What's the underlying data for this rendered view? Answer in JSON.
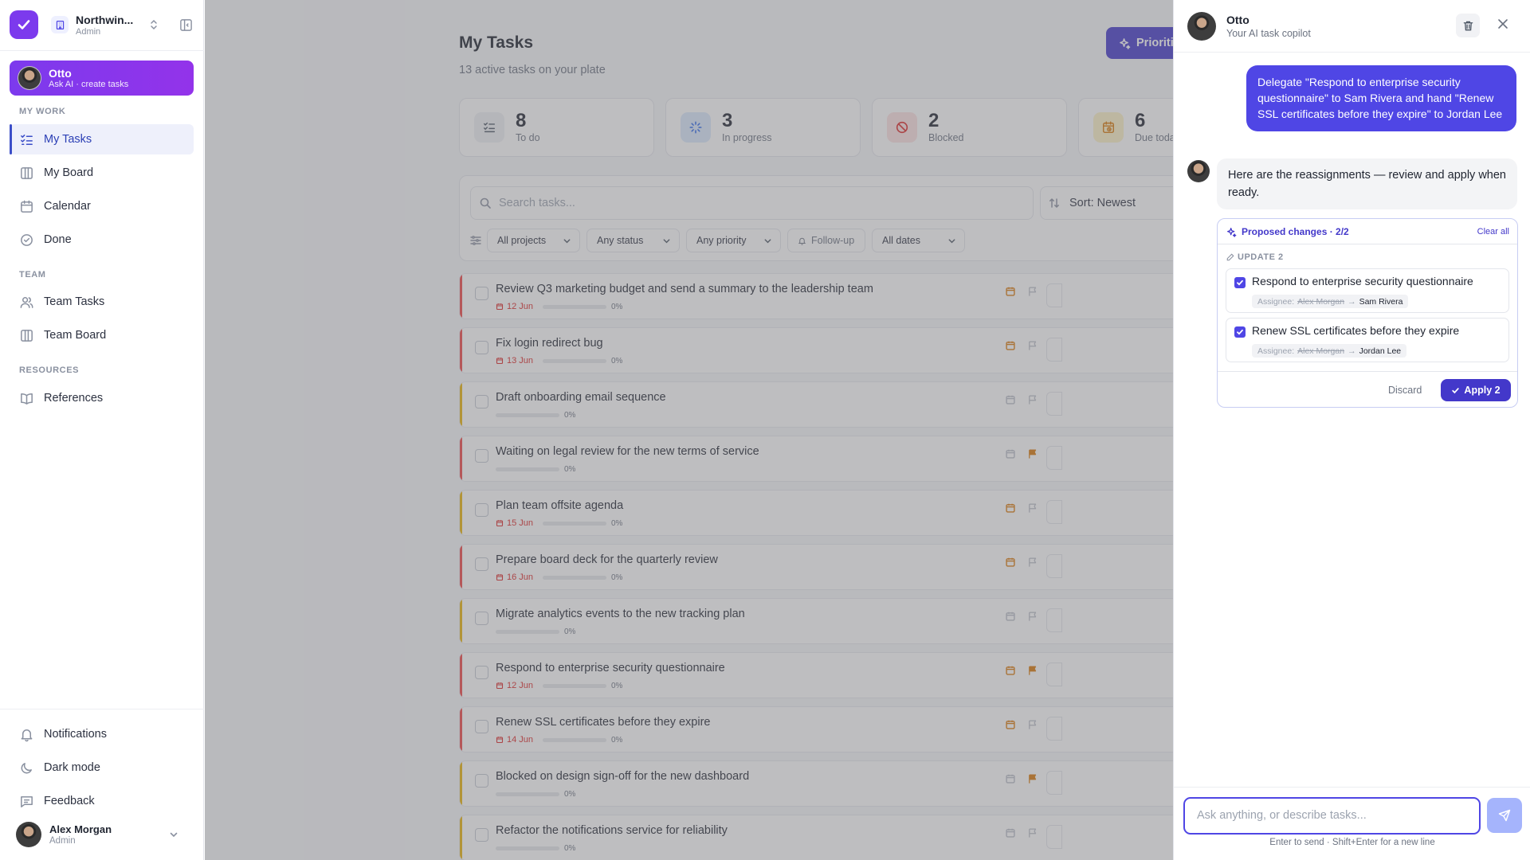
{
  "colors": {
    "accent": "#4338ca",
    "otto_gradient": [
      "#7c3aed",
      "#9333ea"
    ],
    "overdue": "#dc2626",
    "priority_high": "#ef4444",
    "priority_medium": "#eab308"
  },
  "sidebar": {
    "workspace": {
      "name": "Northwin...",
      "role": "Admin"
    },
    "otto": {
      "name": "Otto",
      "subtitle": "Ask AI · create tasks"
    },
    "sections": {
      "my_work": "MY WORK",
      "team": "TEAM",
      "resources": "RESOURCES"
    },
    "nav": {
      "my_tasks": "My Tasks",
      "my_board": "My Board",
      "calendar": "Calendar",
      "done": "Done",
      "team_tasks": "Team Tasks",
      "team_board": "Team Board",
      "references": "References"
    },
    "bottom": {
      "notifications": "Notifications",
      "dark_mode": "Dark mode",
      "feedback": "Feedback"
    },
    "user": {
      "name": "Alex Morgan",
      "role": "Admin"
    }
  },
  "main": {
    "title": "My Tasks",
    "subtitle": "13 active tasks on your plate",
    "prioritize_button": "Prioriti",
    "stats": [
      {
        "value": "8",
        "label": "To do",
        "icon": "list-check-icon"
      },
      {
        "value": "3",
        "label": "In progress",
        "icon": "loader-icon"
      },
      {
        "value": "2",
        "label": "Blocked",
        "icon": "ban-icon"
      },
      {
        "value": "6",
        "label": "Due toda",
        "icon": "calendar-clock-icon"
      }
    ],
    "search": {
      "placeholder": "Search tasks..."
    },
    "sort": {
      "label": "Sort: Newest"
    },
    "filters": {
      "projects": "All projects",
      "status": "Any status",
      "priority": "Any priority",
      "follow_up": "Follow-up",
      "dates": "All dates"
    },
    "tasks": [
      {
        "title": "Review Q3 marketing budget and send a summary to the leadership team",
        "due": "12 Jun",
        "progress": "0%",
        "priority": "high",
        "flagged": false
      },
      {
        "title": "Fix login redirect bug",
        "due": "13 Jun",
        "progress": "0%",
        "priority": "high",
        "flagged": false
      },
      {
        "title": "Draft onboarding email sequence",
        "due": "",
        "progress": "0%",
        "priority": "medium",
        "flagged": false
      },
      {
        "title": "Waiting on legal review for the new terms of service",
        "due": "",
        "progress": "0%",
        "priority": "high",
        "flagged": true
      },
      {
        "title": "Plan team offsite agenda",
        "due": "15 Jun",
        "progress": "0%",
        "priority": "medium",
        "flagged": false
      },
      {
        "title": "Prepare board deck for the quarterly review",
        "due": "16 Jun",
        "progress": "0%",
        "priority": "high",
        "flagged": false
      },
      {
        "title": "Migrate analytics events to the new tracking plan",
        "due": "",
        "progress": "0%",
        "priority": "medium",
        "flagged": false
      },
      {
        "title": "Respond to enterprise security questionnaire",
        "due": "12 Jun",
        "progress": "0%",
        "priority": "high",
        "flagged": true
      },
      {
        "title": "Renew SSL certificates before they expire",
        "due": "14 Jun",
        "progress": "0%",
        "priority": "high",
        "flagged": false
      },
      {
        "title": "Blocked on design sign-off for the new dashboard",
        "due": "",
        "progress": "0%",
        "priority": "medium",
        "flagged": true
      },
      {
        "title": "Refactor the notifications service for reliability",
        "due": "",
        "progress": "0%",
        "priority": "medium",
        "flagged": false
      }
    ]
  },
  "chat": {
    "name": "Otto",
    "subtitle": "Your AI task copilot",
    "user_message": "Delegate \"Respond to enterprise security questionnaire\" to Sam Rivera and hand \"Renew SSL certificates before they expire\" to Jordan Lee",
    "bot_message": "Here are the reassignments — review and apply when ready.",
    "proposal": {
      "header": "Proposed changes · 2/2",
      "clear_all": "Clear all",
      "update_label": "UPDATE 2",
      "changes": [
        {
          "title": "Respond to enterprise security questionnaire",
          "field": "Assignee:",
          "from": "Alex Morgan",
          "arrow": "→",
          "to": "Sam Rivera",
          "checked": true
        },
        {
          "title": "Renew SSL certificates before they expire",
          "field": "Assignee:",
          "from": "Alex Morgan",
          "arrow": "→",
          "to": "Jordan Lee",
          "checked": true
        }
      ],
      "discard": "Discard",
      "apply": "Apply 2"
    },
    "input_placeholder": "Ask anything, or describe tasks...",
    "hint": "Enter to send · Shift+Enter for a new line"
  }
}
